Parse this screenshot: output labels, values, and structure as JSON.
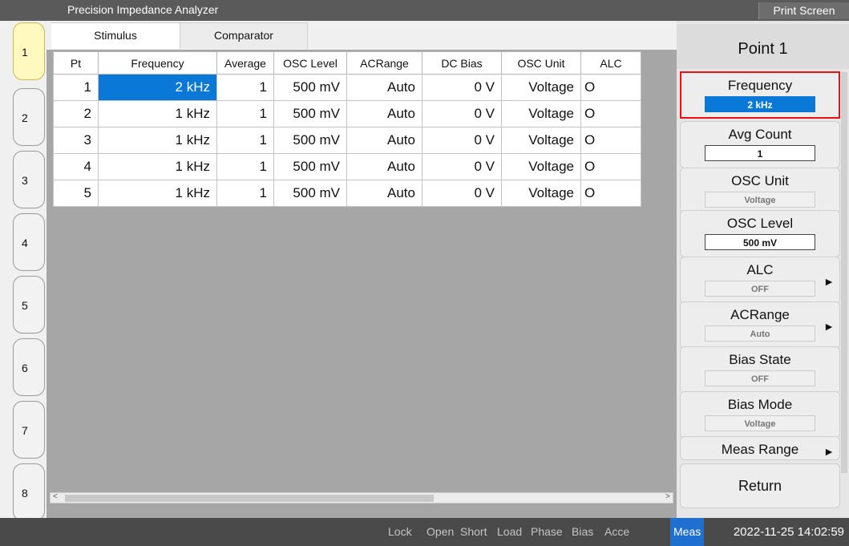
{
  "app": {
    "title": "Precision Impedance Analyzer",
    "print_screen": "Print Screen"
  },
  "side_tabs": [
    "1",
    "2",
    "3",
    "4",
    "5",
    "6",
    "7",
    "8"
  ],
  "tabs": {
    "stimulus": "Stimulus",
    "comparator": "Comparator"
  },
  "table": {
    "headers": [
      "Pt",
      "Frequency",
      "Average",
      "OSC Level",
      "ACRange",
      "DC Bias",
      "OSC Unit",
      "ALC"
    ],
    "rows": [
      [
        "1",
        "2 kHz",
        "1",
        "500 mV",
        "Auto",
        "0 V",
        "Voltage",
        "O"
      ],
      [
        "2",
        "1 kHz",
        "1",
        "500 mV",
        "Auto",
        "0 V",
        "Voltage",
        "O"
      ],
      [
        "3",
        "1 kHz",
        "1",
        "500 mV",
        "Auto",
        "0 V",
        "Voltage",
        "O"
      ],
      [
        "4",
        "1 kHz",
        "1",
        "500 mV",
        "Auto",
        "0 V",
        "Voltage",
        "O"
      ],
      [
        "5",
        "1 kHz",
        "1",
        "500 mV",
        "Auto",
        "0 V",
        "Voltage",
        "O"
      ]
    ]
  },
  "panel": {
    "title": "Point 1",
    "keys": [
      {
        "label": "Frequency",
        "value": "2 kHz"
      },
      {
        "label": "Avg Count",
        "value": "1"
      },
      {
        "label": "OSC Unit",
        "value": "Voltage"
      },
      {
        "label": "OSC Level",
        "value": "500 mV"
      },
      {
        "label": "ALC",
        "value": "OFF"
      },
      {
        "label": "ACRange",
        "value": "Auto"
      },
      {
        "label": "Bias State",
        "value": "OFF"
      },
      {
        "label": "Bias Mode",
        "value": "Voltage"
      },
      {
        "label": "Meas Range",
        "value": ""
      }
    ],
    "return": "Return"
  },
  "status": {
    "items": [
      "Lock",
      "Open",
      "Short",
      "Load",
      "Phase",
      "Bias",
      "Acce",
      "Meas"
    ],
    "datetime": "2022-11-25 14:02:59"
  },
  "colors": {
    "selection": "#0a78d7",
    "focus": "#ee1111",
    "active_tab": "#fff9bf"
  }
}
